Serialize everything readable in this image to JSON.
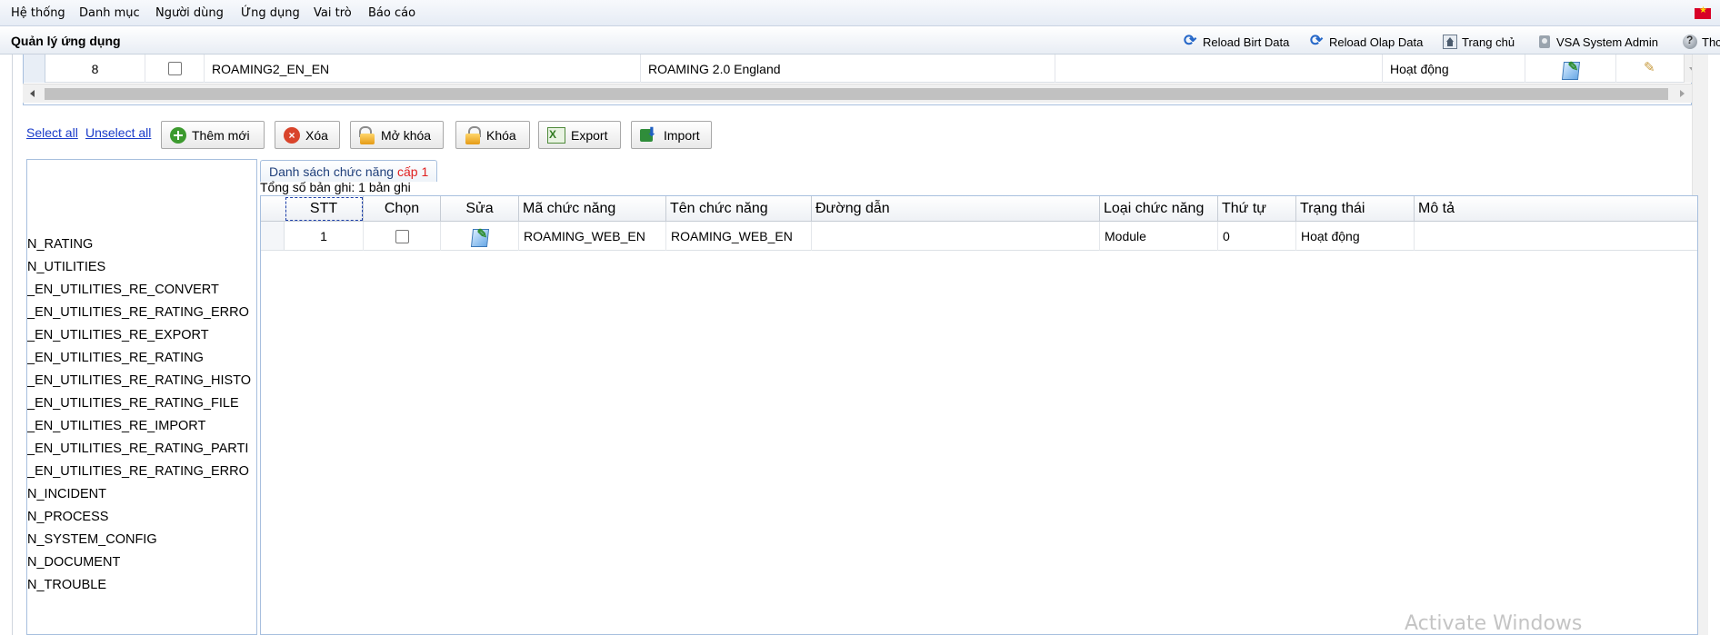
{
  "menu": [
    "Hệ thống",
    "Danh mục",
    "Người dùng",
    "Ứng dụng",
    "Vai trò",
    "Báo cáo"
  ],
  "header": {
    "title": "Quản lý ứng dụng",
    "reload_birt": "Reload Birt Data",
    "reload_olap": "Reload Olap Data",
    "home": "Trang chủ",
    "user": "VSA System Admin",
    "help": "Thc"
  },
  "upper_row": {
    "index": "8",
    "code": "ROAMING2_EN_EN",
    "name": "ROAMING 2.0 England",
    "status": "Hoạt động"
  },
  "toolbar": {
    "select_all": "Select all",
    "unselect_all": "Unselect all",
    "add": "Thêm mới",
    "delete": "Xóa",
    "unlock": "Mở khóa",
    "lock": "Khóa",
    "export": "Export",
    "import": "Import"
  },
  "tree": [
    "N_RATING",
    "N_UTILITIES",
    "_EN_UTILITIES_RE_CONVERT",
    "_EN_UTILITIES_RE_RATING_ERRO",
    "_EN_UTILITIES_RE_EXPORT",
    "_EN_UTILITIES_RE_RATING",
    "_EN_UTILITIES_RE_RATING_HISTO",
    "_EN_UTILITIES_RE_RATING_FILE",
    "_EN_UTILITIES_RE_IMPORT",
    "_EN_UTILITIES_RE_RATING_PARTI",
    "_EN_UTILITIES_RE_RATING_ERRO",
    "N_INCIDENT",
    "N_PROCESS",
    "N_SYSTEM_CONFIG",
    "N_DOCUMENT",
    "N_TROUBLE"
  ],
  "panel": {
    "tab_label": "Danh sách chức năng",
    "tab_level": "cấp 1",
    "total": "Tổng số bản ghi: 1 bản ghi"
  },
  "table": {
    "headers": [
      "STT",
      "Chọn",
      "Sửa",
      "Mã chức năng",
      "Tên chức năng",
      "Đường dẫn",
      "Loại chức năng",
      "Thứ tự",
      "Trạng thái",
      "Mô tả"
    ],
    "rows": [
      {
        "stt": "1",
        "code": "ROAMING_WEB_EN",
        "name": "ROAMING_WEB_EN",
        "path": "",
        "type": "Module",
        "order": "0",
        "status": "Hoạt động",
        "desc": ""
      }
    ]
  },
  "watermark": "Activate Windows",
  "icons": {
    "reload": "reload-icon",
    "home": "home-icon",
    "user": "user-icon",
    "help": "help-icon",
    "flag": "vietnam-flag-icon",
    "edit": "edit-icon"
  }
}
